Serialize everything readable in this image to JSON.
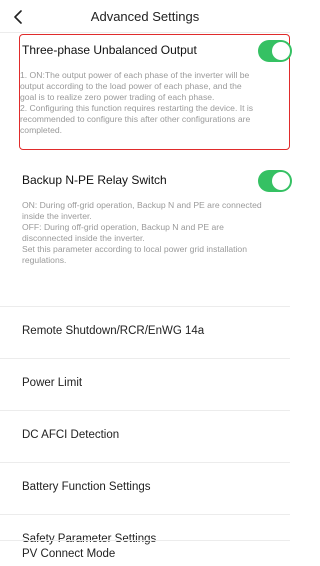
{
  "header": {
    "title": "Advanced Settings",
    "back_icon": "chevron-left-icon"
  },
  "three_phase": {
    "title": "Three-phase Unbalanced Output",
    "enabled": true,
    "desc_lines": [
      "1. ON:The output power of each phase of the inverter will be",
      "output according to the load power of each phase, and the",
      "goal is to realize zero power trading of each phase.",
      "2. Configuring this function requires restarting the device. It is",
      "recommended to configure this after other configurations are",
      "completed."
    ]
  },
  "backup_relay": {
    "title": "Backup N-PE Relay Switch",
    "enabled": true,
    "desc_lines": [
      "ON: During off-grid operation, Backup N and PE are connected",
      "inside the inverter.",
      "OFF: During off-grid operation, Backup N and PE are",
      "disconnected inside the inverter.",
      "Set this parameter according to local power grid installation",
      "regulations."
    ]
  },
  "menu_items": [
    "Remote Shutdown/RCR/EnWG 14a",
    "Power Limit",
    "DC AFCI Detection",
    "Battery Function Settings",
    "Safety Parameter Settings",
    "PV Connect Mode"
  ],
  "colors": {
    "accent": "#35c163",
    "highlight": "#e02b2b",
    "desc_text": "#9a9a9a"
  }
}
